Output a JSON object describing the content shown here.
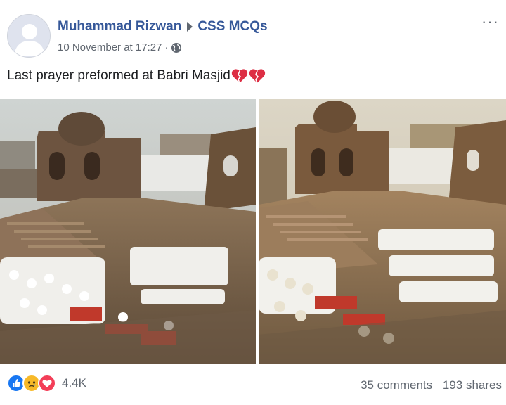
{
  "post": {
    "author": "Muhammad Rizwan",
    "group": "CSS MCQs",
    "timestamp": "10 November at 17:27",
    "separator": "·",
    "privacy_icon": "globe-icon",
    "more_label": "···",
    "text": "Last prayer preformed at Babri Masjid",
    "emoji": [
      "broken-heart-icon",
      "broken-heart-icon"
    ]
  },
  "photos": [
    {
      "name": "photo-left",
      "description_icon": "mosque-prayer-photo"
    },
    {
      "name": "photo-right",
      "description_icon": "mosque-prayer-photo"
    }
  ],
  "footer": {
    "reaction_icons": [
      "like-icon",
      "sad-icon",
      "love-icon"
    ],
    "reaction_count": "4.4K",
    "comments": "35 comments",
    "shares": "193 shares"
  },
  "colors": {
    "link": "#365899",
    "secondary_text": "#606770",
    "like": "#1877f2",
    "sad": "#f7b928",
    "love": "#f33e58"
  }
}
